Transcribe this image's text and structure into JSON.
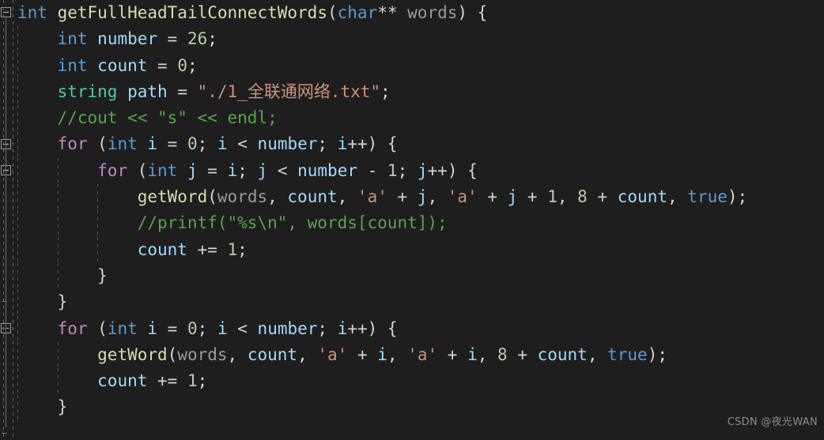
{
  "editor": {
    "language": "cpp",
    "background_color": "#1e1e1e",
    "font_size_px": 21,
    "line_height_px": 33.3
  },
  "theme": {
    "keyword_color": "#569cd6",
    "control_keyword_color": "#c586c0",
    "type_color": "#4ec9b0",
    "function_color": "#dcdcaa",
    "variable_color": "#9cdcfe",
    "parameter_color": "#9a9a9a",
    "number_color": "#b5cea8",
    "string_color": "#ce9178",
    "comment_color": "#56a64a",
    "punctuation_color": "#d4d4d4"
  },
  "gutter": {
    "fold_markers": [
      {
        "name": "fold-function",
        "line": 0,
        "state": "expanded"
      },
      {
        "name": "fold-outer-for",
        "line": 5,
        "state": "expanded"
      },
      {
        "name": "fold-inner-for",
        "line": 6,
        "state": "expanded"
      },
      {
        "name": "fold-second-for",
        "line": 12,
        "state": "expanded"
      }
    ]
  },
  "code": {
    "lines": [
      {
        "n": 1,
        "indent": 0,
        "text": "int getFullHeadTailConnectWords(char** words) {",
        "tokens": [
          {
            "t": "int",
            "c": "kw"
          },
          {
            "t": " ",
            "c": "punc"
          },
          {
            "t": "getFullHeadTailConnectWords",
            "c": "fn"
          },
          {
            "t": "(",
            "c": "punc"
          },
          {
            "t": "char",
            "c": "kw"
          },
          {
            "t": "** ",
            "c": "punc"
          },
          {
            "t": "words",
            "c": "param"
          },
          {
            "t": ") {",
            "c": "punc"
          }
        ]
      },
      {
        "n": 2,
        "indent": 1,
        "text": "    int number = 26;",
        "tokens": [
          {
            "t": "    ",
            "c": "punc"
          },
          {
            "t": "int",
            "c": "kw"
          },
          {
            "t": " ",
            "c": "punc"
          },
          {
            "t": "number",
            "c": "var"
          },
          {
            "t": " = ",
            "c": "punc"
          },
          {
            "t": "26",
            "c": "num"
          },
          {
            "t": ";",
            "c": "punc"
          }
        ]
      },
      {
        "n": 3,
        "indent": 1,
        "text": "    int count = 0;",
        "tokens": [
          {
            "t": "    ",
            "c": "punc"
          },
          {
            "t": "int",
            "c": "kw"
          },
          {
            "t": " ",
            "c": "punc"
          },
          {
            "t": "count",
            "c": "var"
          },
          {
            "t": " = ",
            "c": "punc"
          },
          {
            "t": "0",
            "c": "num"
          },
          {
            "t": ";",
            "c": "punc"
          }
        ]
      },
      {
        "n": 4,
        "indent": 1,
        "text": "    string path = \"./1_全联通网络.txt\";",
        "tokens": [
          {
            "t": "    ",
            "c": "punc"
          },
          {
            "t": "string",
            "c": "type"
          },
          {
            "t": " ",
            "c": "punc"
          },
          {
            "t": "path",
            "c": "var"
          },
          {
            "t": " = ",
            "c": "punc"
          },
          {
            "t": "\"./1_全联通网络.txt\"",
            "c": "str"
          },
          {
            "t": ";",
            "c": "punc"
          }
        ]
      },
      {
        "n": 5,
        "indent": 1,
        "text": "    //cout << \"s\" << endl;",
        "tokens": [
          {
            "t": "    ",
            "c": "punc"
          },
          {
            "t": "//cout << \"s\" << endl;",
            "c": "cmt"
          }
        ]
      },
      {
        "n": 6,
        "indent": 1,
        "text": "    for (int i = 0; i < number; i++) {",
        "tokens": [
          {
            "t": "    ",
            "c": "punc"
          },
          {
            "t": "for",
            "c": "ctrl"
          },
          {
            "t": " (",
            "c": "punc"
          },
          {
            "t": "int",
            "c": "kw"
          },
          {
            "t": " ",
            "c": "punc"
          },
          {
            "t": "i",
            "c": "var"
          },
          {
            "t": " = ",
            "c": "punc"
          },
          {
            "t": "0",
            "c": "num"
          },
          {
            "t": "; ",
            "c": "punc"
          },
          {
            "t": "i",
            "c": "var"
          },
          {
            "t": " < ",
            "c": "punc"
          },
          {
            "t": "number",
            "c": "var"
          },
          {
            "t": "; ",
            "c": "punc"
          },
          {
            "t": "i",
            "c": "var"
          },
          {
            "t": "++) {",
            "c": "punc"
          }
        ]
      },
      {
        "n": 7,
        "indent": 2,
        "text": "        for (int j = i; j < number - 1; j++) {",
        "tokens": [
          {
            "t": "        ",
            "c": "punc"
          },
          {
            "t": "for",
            "c": "ctrl"
          },
          {
            "t": " (",
            "c": "punc"
          },
          {
            "t": "int",
            "c": "kw"
          },
          {
            "t": " ",
            "c": "punc"
          },
          {
            "t": "j",
            "c": "var"
          },
          {
            "t": " = ",
            "c": "punc"
          },
          {
            "t": "i",
            "c": "var"
          },
          {
            "t": "; ",
            "c": "punc"
          },
          {
            "t": "j",
            "c": "var"
          },
          {
            "t": " < ",
            "c": "punc"
          },
          {
            "t": "number",
            "c": "var"
          },
          {
            "t": " - ",
            "c": "punc"
          },
          {
            "t": "1",
            "c": "num"
          },
          {
            "t": "; ",
            "c": "punc"
          },
          {
            "t": "j",
            "c": "var"
          },
          {
            "t": "++) {",
            "c": "punc"
          }
        ]
      },
      {
        "n": 8,
        "indent": 3,
        "text": "            getWord(words, count, 'a' + j, 'a' + j + 1, 8 + count, true);",
        "tokens": [
          {
            "t": "            ",
            "c": "punc"
          },
          {
            "t": "getWord",
            "c": "fn"
          },
          {
            "t": "(",
            "c": "punc"
          },
          {
            "t": "words",
            "c": "param"
          },
          {
            "t": ", ",
            "c": "punc"
          },
          {
            "t": "count",
            "c": "var"
          },
          {
            "t": ", ",
            "c": "punc"
          },
          {
            "t": "'a'",
            "c": "str"
          },
          {
            "t": " + ",
            "c": "punc"
          },
          {
            "t": "j",
            "c": "var"
          },
          {
            "t": ", ",
            "c": "punc"
          },
          {
            "t": "'a'",
            "c": "str"
          },
          {
            "t": " + ",
            "c": "punc"
          },
          {
            "t": "j",
            "c": "var"
          },
          {
            "t": " + ",
            "c": "punc"
          },
          {
            "t": "1",
            "c": "num"
          },
          {
            "t": ", ",
            "c": "punc"
          },
          {
            "t": "8",
            "c": "num"
          },
          {
            "t": " + ",
            "c": "punc"
          },
          {
            "t": "count",
            "c": "var"
          },
          {
            "t": ", ",
            "c": "punc"
          },
          {
            "t": "true",
            "c": "kw"
          },
          {
            "t": ");",
            "c": "punc"
          }
        ]
      },
      {
        "n": 9,
        "indent": 3,
        "text": "            //printf(\"%s\\n\", words[count]);",
        "tokens": [
          {
            "t": "            ",
            "c": "punc"
          },
          {
            "t": "//printf(\"%s\\n\", words[count]);",
            "c": "cmt"
          }
        ]
      },
      {
        "n": 10,
        "indent": 3,
        "text": "            count += 1;",
        "tokens": [
          {
            "t": "            ",
            "c": "punc"
          },
          {
            "t": "count",
            "c": "var"
          },
          {
            "t": " += ",
            "c": "punc"
          },
          {
            "t": "1",
            "c": "num"
          },
          {
            "t": ";",
            "c": "punc"
          }
        ]
      },
      {
        "n": 11,
        "indent": 2,
        "text": "        }",
        "tokens": [
          {
            "t": "        ",
            "c": "punc"
          },
          {
            "t": "}",
            "c": "punc"
          }
        ]
      },
      {
        "n": 12,
        "indent": 1,
        "text": "    }",
        "tokens": [
          {
            "t": "    ",
            "c": "punc"
          },
          {
            "t": "}",
            "c": "punc"
          }
        ]
      },
      {
        "n": 13,
        "indent": 1,
        "text": "    for (int i = 0; i < number; i++) {",
        "tokens": [
          {
            "t": "    ",
            "c": "punc"
          },
          {
            "t": "for",
            "c": "ctrl"
          },
          {
            "t": " (",
            "c": "punc"
          },
          {
            "t": "int",
            "c": "kw"
          },
          {
            "t": " ",
            "c": "punc"
          },
          {
            "t": "i",
            "c": "var"
          },
          {
            "t": " = ",
            "c": "punc"
          },
          {
            "t": "0",
            "c": "num"
          },
          {
            "t": "; ",
            "c": "punc"
          },
          {
            "t": "i",
            "c": "var"
          },
          {
            "t": " < ",
            "c": "punc"
          },
          {
            "t": "number",
            "c": "var"
          },
          {
            "t": "; ",
            "c": "punc"
          },
          {
            "t": "i",
            "c": "var"
          },
          {
            "t": "++) {",
            "c": "punc"
          }
        ]
      },
      {
        "n": 14,
        "indent": 2,
        "text": "        getWord(words, count, 'a' + i, 'a' + i, 8 + count, true);",
        "tokens": [
          {
            "t": "        ",
            "c": "punc"
          },
          {
            "t": "getWord",
            "c": "fn"
          },
          {
            "t": "(",
            "c": "punc"
          },
          {
            "t": "words",
            "c": "param"
          },
          {
            "t": ", ",
            "c": "punc"
          },
          {
            "t": "count",
            "c": "var"
          },
          {
            "t": ", ",
            "c": "punc"
          },
          {
            "t": "'a'",
            "c": "str"
          },
          {
            "t": " + ",
            "c": "punc"
          },
          {
            "t": "i",
            "c": "var"
          },
          {
            "t": ", ",
            "c": "punc"
          },
          {
            "t": "'a'",
            "c": "str"
          },
          {
            "t": " + ",
            "c": "punc"
          },
          {
            "t": "i",
            "c": "var"
          },
          {
            "t": ", ",
            "c": "punc"
          },
          {
            "t": "8",
            "c": "num"
          },
          {
            "t": " + ",
            "c": "punc"
          },
          {
            "t": "count",
            "c": "var"
          },
          {
            "t": ", ",
            "c": "punc"
          },
          {
            "t": "true",
            "c": "kw"
          },
          {
            "t": ");",
            "c": "punc"
          }
        ]
      },
      {
        "n": 15,
        "indent": 2,
        "text": "        count += 1;",
        "tokens": [
          {
            "t": "        ",
            "c": "punc"
          },
          {
            "t": "count",
            "c": "var"
          },
          {
            "t": " += ",
            "c": "punc"
          },
          {
            "t": "1",
            "c": "num"
          },
          {
            "t": ";",
            "c": "punc"
          }
        ]
      },
      {
        "n": 16,
        "indent": 1,
        "text": "    }",
        "tokens": [
          {
            "t": "    ",
            "c": "punc"
          },
          {
            "t": "}",
            "c": "punc"
          }
        ]
      }
    ]
  },
  "watermark": {
    "text": "CSDN @夜光WAN"
  }
}
